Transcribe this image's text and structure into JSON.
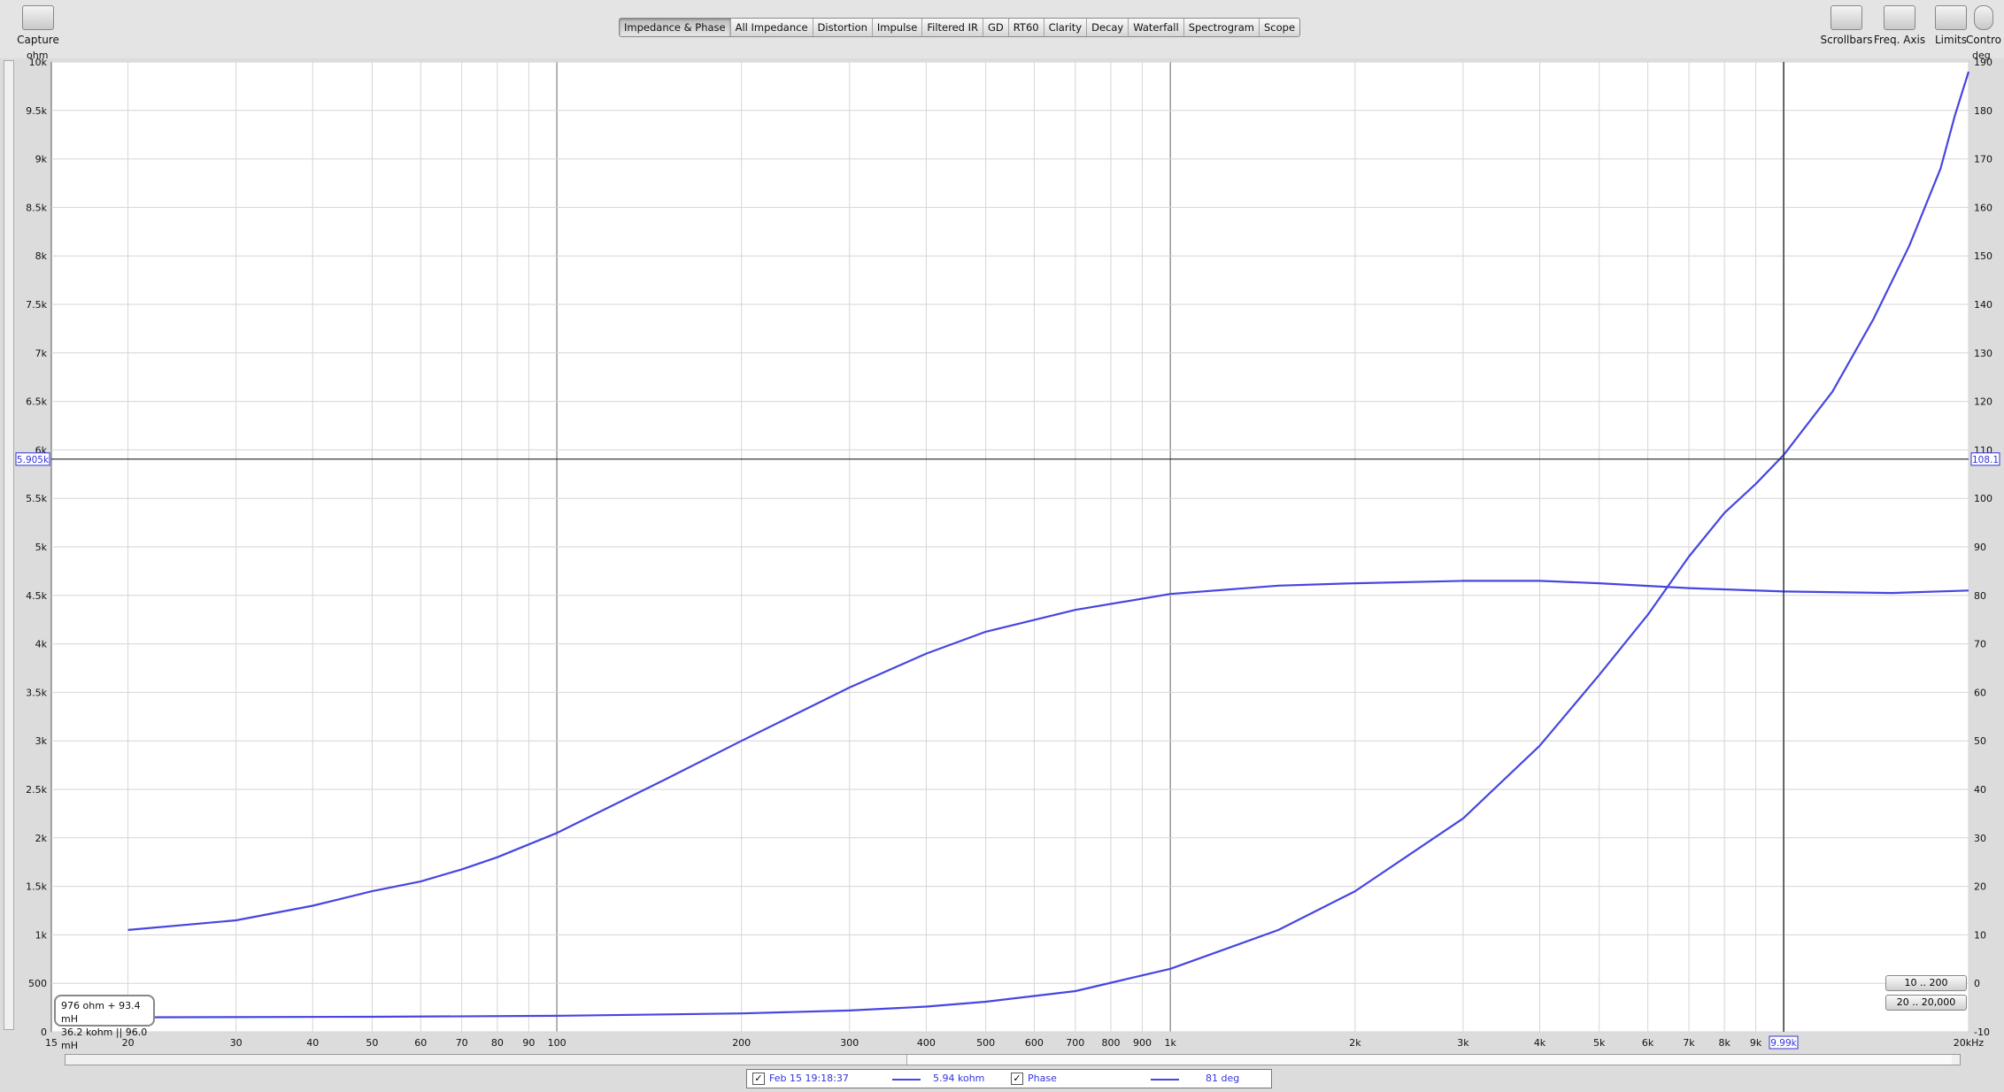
{
  "toolbar": {
    "capture_label": "Capture",
    "right_tools": [
      "Scrollbars",
      "Freq. Axis",
      "Limits",
      "Contro"
    ]
  },
  "tabs": [
    {
      "label": "Impedance & Phase",
      "active": true
    },
    {
      "label": "All Impedance"
    },
    {
      "label": "Distortion"
    },
    {
      "label": "Impulse"
    },
    {
      "label": "Filtered IR"
    },
    {
      "label": "GD"
    },
    {
      "label": "RT60"
    },
    {
      "label": "Clarity"
    },
    {
      "label": "Decay"
    },
    {
      "label": "Waterfall"
    },
    {
      "label": "Spectrogram"
    },
    {
      "label": "Scope"
    }
  ],
  "chart_data": {
    "type": "line",
    "x_axis": {
      "scale": "log",
      "range": [
        15,
        20000
      ],
      "unit_label": "Hz",
      "ticks": [
        {
          "v": 15,
          "l": "15"
        },
        {
          "v": 20,
          "l": "20"
        },
        {
          "v": 30,
          "l": "30"
        },
        {
          "v": 40,
          "l": "40"
        },
        {
          "v": 50,
          "l": "50"
        },
        {
          "v": 60,
          "l": "60"
        },
        {
          "v": 70,
          "l": "70"
        },
        {
          "v": 80,
          "l": "80"
        },
        {
          "v": 90,
          "l": "90"
        },
        {
          "v": 100,
          "l": "100"
        },
        {
          "v": 200,
          "l": "200"
        },
        {
          "v": 300,
          "l": "300"
        },
        {
          "v": 400,
          "l": "400"
        },
        {
          "v": 500,
          "l": "500"
        },
        {
          "v": 600,
          "l": "600"
        },
        {
          "v": 700,
          "l": "700"
        },
        {
          "v": 800,
          "l": "800"
        },
        {
          "v": 900,
          "l": "900"
        },
        {
          "v": 1000,
          "l": "1k"
        },
        {
          "v": 2000,
          "l": "2k"
        },
        {
          "v": 3000,
          "l": "3k"
        },
        {
          "v": 4000,
          "l": "4k"
        },
        {
          "v": 5000,
          "l": "5k"
        },
        {
          "v": 6000,
          "l": "6k"
        },
        {
          "v": 7000,
          "l": "7k"
        },
        {
          "v": 8000,
          "l": "8k"
        },
        {
          "v": 9000,
          "l": "9k"
        },
        {
          "v": 20000,
          "l": "20kHz"
        }
      ]
    },
    "y_left": {
      "label": "ohm",
      "range": [
        0,
        10000
      ],
      "ticks": [
        "0",
        "500",
        "1k",
        "1.5k",
        "2k",
        "2.5k",
        "3k",
        "3.5k",
        "4k",
        "4.5k",
        "5k",
        "5.5k",
        "6k",
        "6.5k",
        "7k",
        "7.5k",
        "8k",
        "8.5k",
        "9k",
        "9.5k",
        "10k"
      ]
    },
    "y_right": {
      "label": "deg",
      "range": [
        -10,
        190
      ],
      "ticks": [
        "-10",
        "0",
        "10",
        "20",
        "30",
        "40",
        "50",
        "60",
        "70",
        "80",
        "90",
        "100",
        "110",
        "120",
        "130",
        "140",
        "150",
        "160",
        "170",
        "180",
        "190"
      ]
    },
    "grid": true,
    "cursor": {
      "x": 9990,
      "x_label": "9.99k",
      "y_left_label": "5.905k",
      "y_right_label": "108.1"
    },
    "series": [
      {
        "name": "Impedance",
        "axis": "left",
        "color": "#4646e0",
        "points": [
          [
            20,
            150
          ],
          [
            50,
            155
          ],
          [
            100,
            165
          ],
          [
            200,
            190
          ],
          [
            300,
            220
          ],
          [
            400,
            260
          ],
          [
            500,
            310
          ],
          [
            700,
            420
          ],
          [
            1000,
            650
          ],
          [
            1500,
            1050
          ],
          [
            2000,
            1450
          ],
          [
            3000,
            2200
          ],
          [
            4000,
            2950
          ],
          [
            5000,
            3680
          ],
          [
            6000,
            4300
          ],
          [
            7000,
            4900
          ],
          [
            8000,
            5350
          ],
          [
            9000,
            5650
          ],
          [
            10000,
            5950
          ],
          [
            12000,
            6600
          ],
          [
            14000,
            7350
          ],
          [
            16000,
            8100
          ],
          [
            18000,
            8900
          ],
          [
            19000,
            9450
          ],
          [
            20000,
            9900
          ]
        ]
      },
      {
        "name": "Phase",
        "axis": "right",
        "color": "#4646e0",
        "points": [
          [
            20,
            11
          ],
          [
            30,
            13
          ],
          [
            40,
            16
          ],
          [
            50,
            19
          ],
          [
            60,
            21
          ],
          [
            70,
            23.5
          ],
          [
            80,
            26
          ],
          [
            100,
            31
          ],
          [
            150,
            42
          ],
          [
            200,
            50
          ],
          [
            300,
            61
          ],
          [
            400,
            68
          ],
          [
            500,
            72.5
          ],
          [
            700,
            77
          ],
          [
            1000,
            80.3
          ],
          [
            1500,
            82
          ],
          [
            2000,
            82.5
          ],
          [
            3000,
            83
          ],
          [
            4000,
            83
          ],
          [
            5000,
            82.5
          ],
          [
            7000,
            81.5
          ],
          [
            10000,
            80.8
          ],
          [
            15000,
            80.5
          ],
          [
            20000,
            81
          ]
        ]
      }
    ]
  },
  "legend": {
    "measurement_label": "Feb 15 19:18:37",
    "impedance_value": "5.94 kohm",
    "phase_label": "Phase",
    "phase_value": "81 deg"
  },
  "info_box": {
    "line1": "976 ohm + 93.4 mH",
    "line2": "36.2 kohm || 96.0 mH"
  },
  "range_buttons": {
    "btn1": "10 .. 200",
    "btn2": "20 .. 20,000"
  }
}
